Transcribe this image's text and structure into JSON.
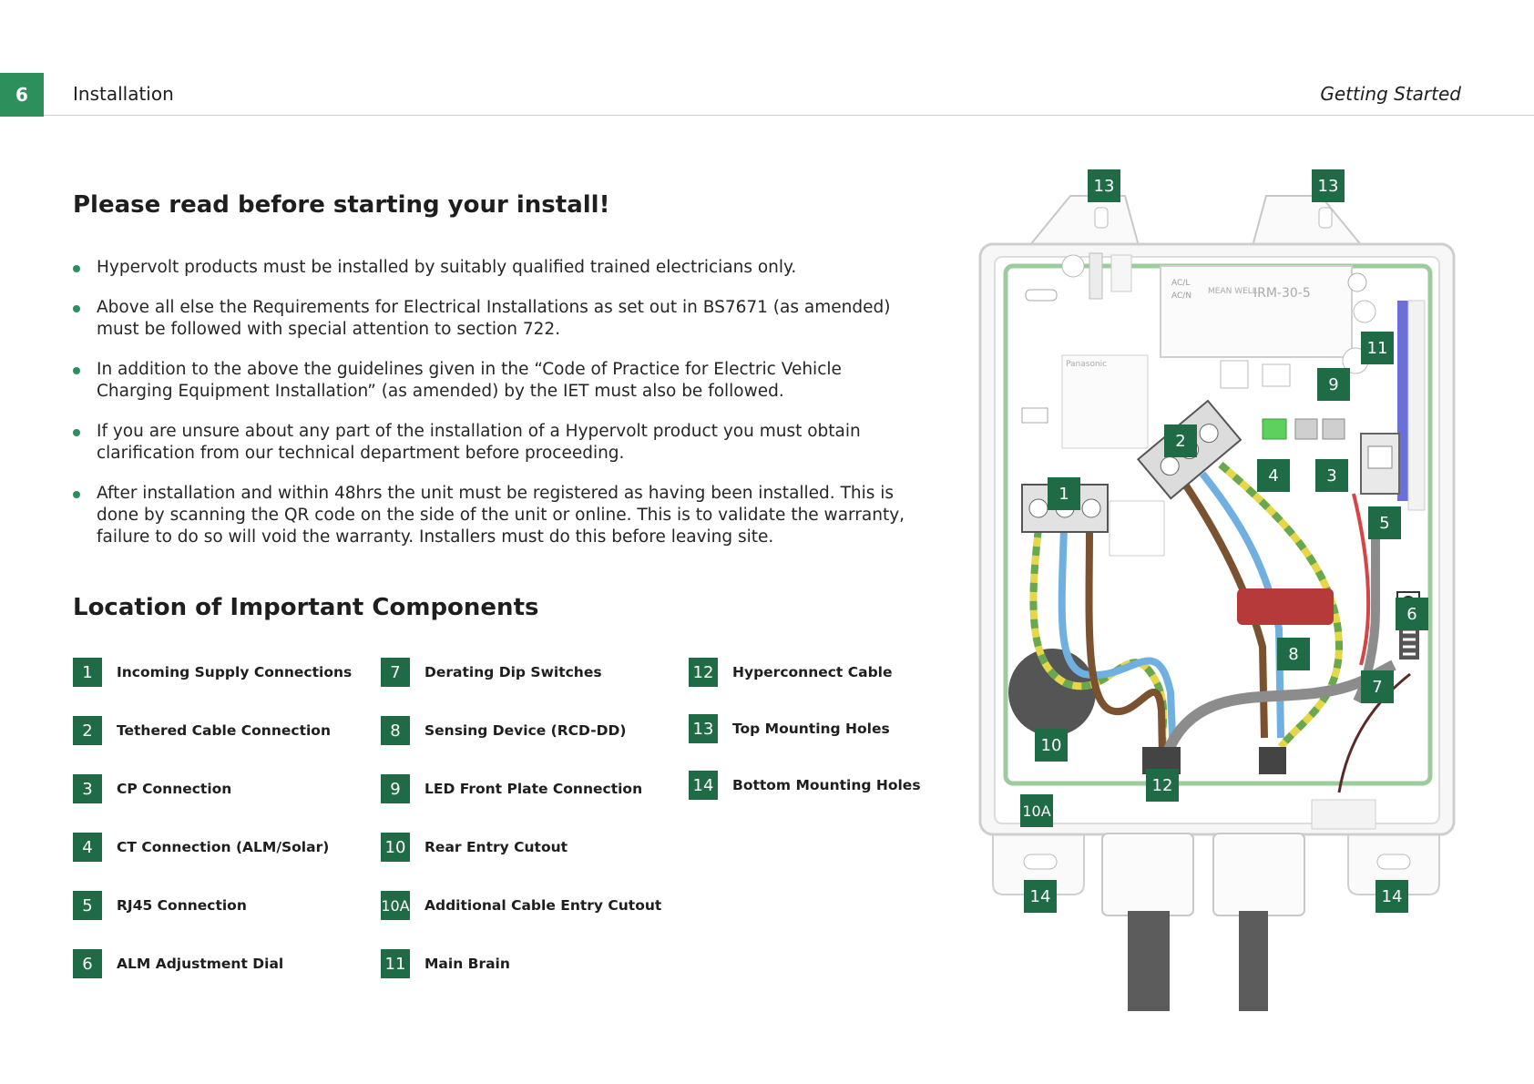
{
  "header": {
    "page_number": "6",
    "section": "Installation",
    "chapter": "Getting Started"
  },
  "main": {
    "heading": "Please read before starting your install!",
    "bullets": [
      "Hypervolt products must be installed by suitably qualified trained electricians only.",
      "Above all else the Requirements for Electrical Installations as set out in BS7671 (as amended) must be followed with special attention to section 722.",
      "In addition to the above the guidelines given in the “Code of Practice for Electric Vehicle Charging Equipment Installation” (as amended) by the IET must also be followed.",
      "If you are unsure about any part of the installation of a Hypervolt product you must obtain clarification from our technical department before proceeding.",
      "After installation and within 48hrs the unit must be registered as having been installed. This is done by scanning the QR code on the side of the unit or online. This is to validate the warranty, failure to do so will void the warranty. Installers must do this before leaving site."
    ],
    "components_heading": "Location of Important Components",
    "components": [
      {
        "num": "1",
        "label": "Incoming Supply Connections"
      },
      {
        "num": "2",
        "label": "Tethered Cable Connection"
      },
      {
        "num": "3",
        "label": "CP Connection"
      },
      {
        "num": "4",
        "label": "CT Connection (ALM/Solar)"
      },
      {
        "num": "5",
        "label": "RJ45 Connection"
      },
      {
        "num": "6",
        "label": "ALM Adjustment Dial"
      },
      {
        "num": "7",
        "label": "Derating Dip Switches"
      },
      {
        "num": "8",
        "label": "Sensing Device (RCD-DD)"
      },
      {
        "num": "9",
        "label": "LED Front Plate Connection"
      },
      {
        "num": "10",
        "label": "Rear Entry Cutout"
      },
      {
        "num": "10A",
        "label": "Additional Cable Entry Cutout"
      },
      {
        "num": "11",
        "label": "Main Brain"
      },
      {
        "num": "12",
        "label": "Hyperconnect Cable"
      },
      {
        "num": "13",
        "label": "Top Mounting Holes"
      },
      {
        "num": "14",
        "label": "Bottom Mounting Holes"
      }
    ]
  },
  "diagram": {
    "psu_brand": "MEAN WELL",
    "psu_model": "IRM-30-5",
    "psu_ac_l": "AC/L",
    "psu_ac_n": "AC/N",
    "relay_brand": "Panasonic",
    "callouts": {
      "c13a": "13",
      "c13b": "13",
      "c11": "11",
      "c9": "9",
      "c2": "2",
      "c4": "4",
      "c3": "3",
      "c1": "1",
      "c5": "5",
      "c6": "6",
      "c8": "8",
      "c7": "7",
      "c10": "10",
      "c12": "12",
      "c10a": "10A",
      "c14a": "14",
      "c14b": "14"
    }
  },
  "colors": {
    "brand_green": "#2d8f5b",
    "callout_green": "#1f6b45",
    "wire_brown": "#7a5230",
    "wire_blue": "#6fb0e0",
    "wire_earth_green": "#6aa84f",
    "wire_earth_yellow": "#e6d64a",
    "wire_grey": "#8c8c8c",
    "wire_red": "#d64545",
    "rcd_red": "#b63a3a"
  }
}
